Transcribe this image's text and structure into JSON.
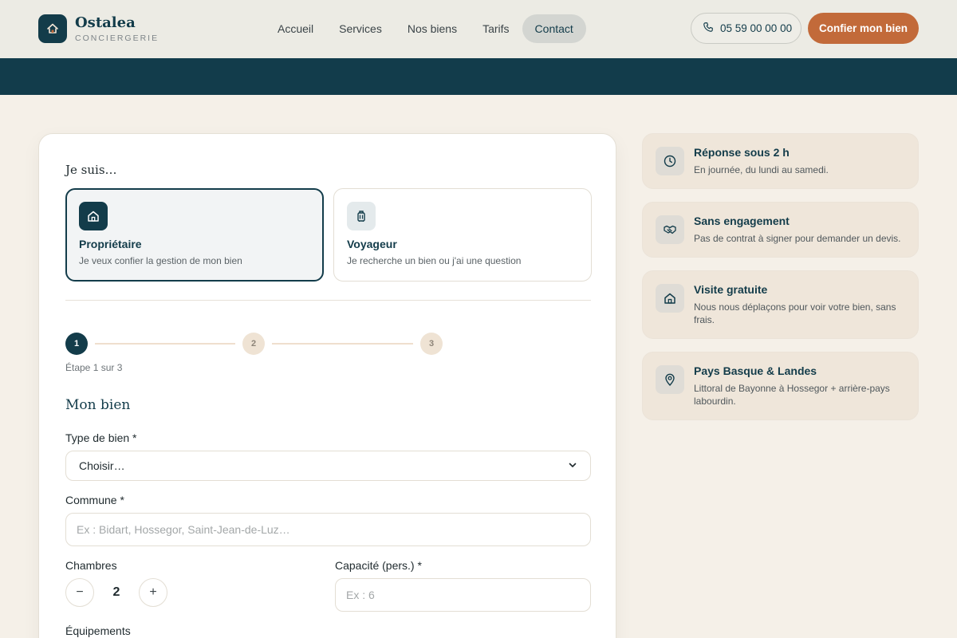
{
  "header": {
    "brand_name": "Ostalea",
    "brand_sub": "CONCIERGERIE",
    "nav": [
      {
        "label": "Accueil",
        "active": false
      },
      {
        "label": "Services",
        "active": false
      },
      {
        "label": "Nos biens",
        "active": false
      },
      {
        "label": "Tarifs",
        "active": false
      },
      {
        "label": "Contact",
        "active": true
      }
    ],
    "phone": "05 59 00 00 00",
    "cta": "Confier mon bien"
  },
  "form": {
    "heading": "Je suis…",
    "roles": [
      {
        "title": "Propriétaire",
        "desc": "Je veux confier la gestion de mon bien",
        "icon": "home-icon",
        "selected": true
      },
      {
        "title": "Voyageur",
        "desc": "Je recherche un bien ou j'ai une question",
        "icon": "luggage-icon",
        "selected": false
      }
    ],
    "steps": [
      "1",
      "2",
      "3"
    ],
    "current_step": 1,
    "step_label": "Étape 1 sur 3",
    "section_title": "Mon bien",
    "type_label": "Type de bien *",
    "type_value": "Choisir…",
    "commune_label": "Commune *",
    "commune_placeholder": "Ex : Bidart, Hossegor, Saint-Jean-de-Luz…",
    "chambres_label": "Chambres",
    "chambres_value": "2",
    "capacite_label": "Capacité (pers.) *",
    "capacite_placeholder": "Ex : 6",
    "equipements_label": "Équipements"
  },
  "features": [
    {
      "title": "Réponse sous 2 h",
      "desc": "En journée, du lundi au samedi.",
      "icon": "clock-icon"
    },
    {
      "title": "Sans engagement",
      "desc": "Pas de contrat à signer pour demander un devis.",
      "icon": "handshake-icon"
    },
    {
      "title": "Visite gratuite",
      "desc": "Nous nous déplaçons pour voir votre bien, sans frais.",
      "icon": "home-icon"
    },
    {
      "title": "Pays Basque & Landes",
      "desc": "Littoral de Bayonne à Hossegor + arrière-pays labourdin.",
      "icon": "map-pin-icon"
    }
  ],
  "colors": {
    "primary": "#133c4a",
    "accent": "#c26a3a",
    "background": "#f5f0e8",
    "feature_bg": "#efe6da"
  }
}
